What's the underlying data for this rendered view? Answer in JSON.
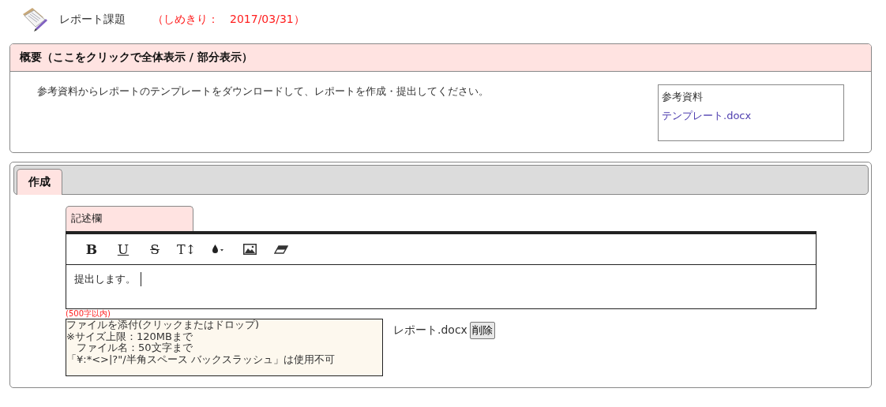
{
  "header": {
    "title": "レポート課題",
    "deadline": "（しめきり：　2017/03/31）"
  },
  "overview": {
    "heading": "概要（ここをクリックで全体表示 / 部分表示）",
    "description": "参考資料からレポートのテンプレートをダウンロードして、レポートを作成・提出してください。",
    "references": {
      "title": "参考資料",
      "links": [
        "テンプレート.docx"
      ]
    }
  },
  "tabs": [
    {
      "label": "作成",
      "selected": true
    }
  ],
  "editor": {
    "tab_label": "記述欄",
    "toolbar": [
      {
        "kind": "bold",
        "label": "B"
      },
      {
        "kind": "underline",
        "label": "U"
      },
      {
        "kind": "strike",
        "label": "S"
      },
      {
        "kind": "size",
        "label": "T↕"
      },
      {
        "kind": "color"
      },
      {
        "kind": "image"
      },
      {
        "kind": "eraser"
      }
    ],
    "content": "提出します。",
    "limit": "(500字以内)"
  },
  "attachment": {
    "lines": [
      "ファイルを添付(クリックまたはドロップ)",
      "※サイズ上限：120MBまで",
      "　ファイル名：50文字まで",
      "「¥:*<>|?\"/半角スペース バックスラッシュ」は使用不可"
    ],
    "files": [
      {
        "name": "レポート.docx",
        "delete_label": "削除"
      }
    ]
  }
}
